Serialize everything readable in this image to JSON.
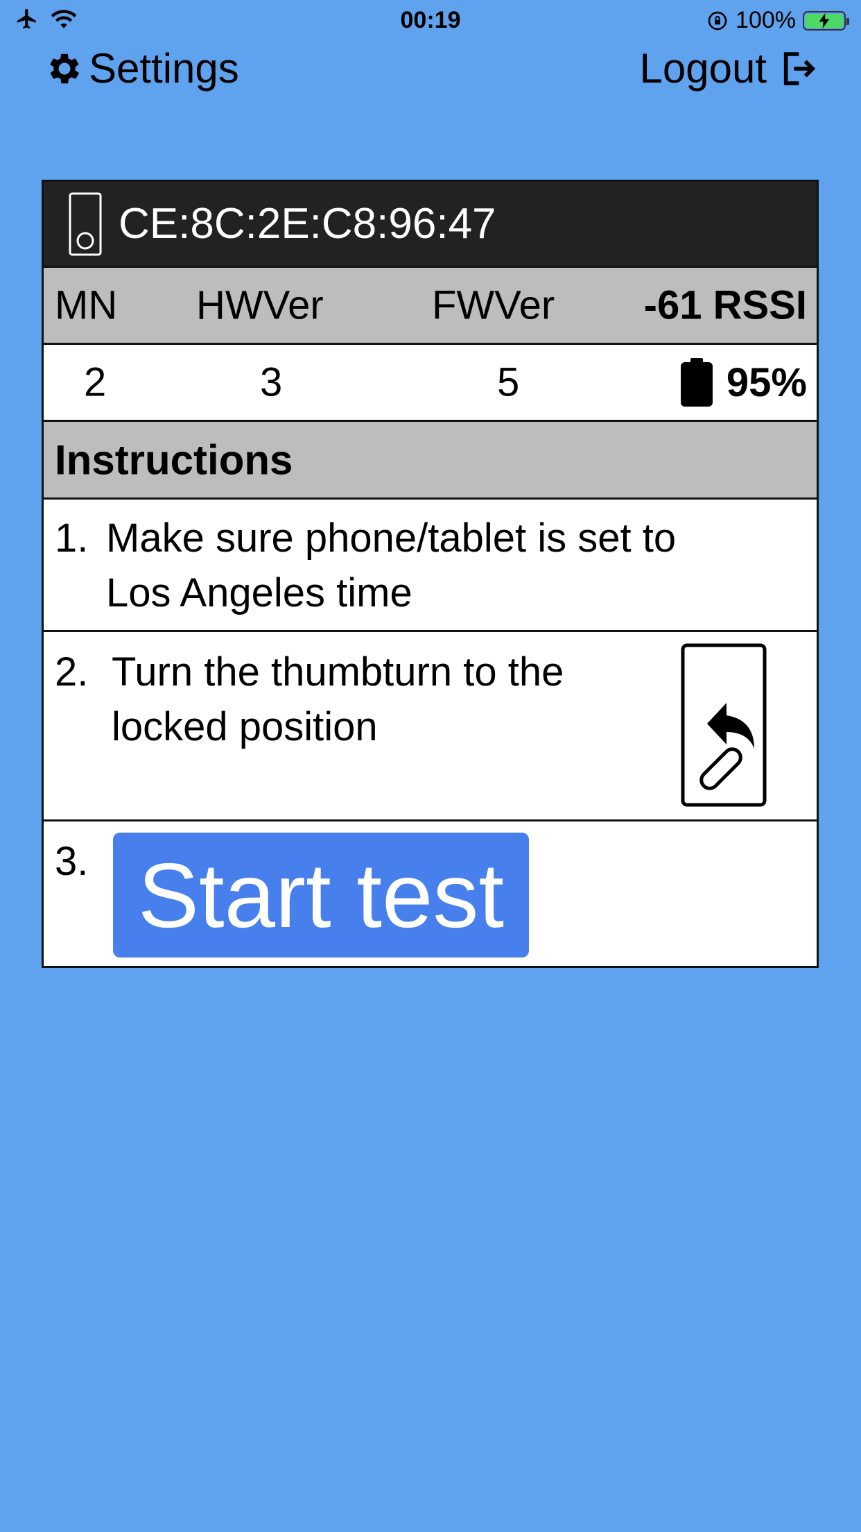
{
  "status_bar": {
    "time": "00:19",
    "battery": "100%"
  },
  "nav": {
    "settings_label": "Settings",
    "logout_label": "Logout"
  },
  "device": {
    "mac": "CE:8C:2E:C8:96:47",
    "headers": {
      "mn": "MN",
      "hwver": "HWVer",
      "fwver": "FWVer",
      "rssi": "-61 RSSI"
    },
    "values": {
      "mn": "2",
      "hwver": "3",
      "fwver": "5",
      "battery": "95%"
    }
  },
  "instructions": {
    "title": "Instructions",
    "steps": [
      {
        "num": "1.",
        "line1": "Make sure phone/tablet is set to",
        "line2": "Los Angeles time"
      },
      {
        "num": "2.",
        "line1": "Turn the thumbturn to the",
        "line2": "locked position"
      },
      {
        "num": "3.",
        "button_label": "Start test"
      }
    ]
  },
  "icons": {
    "status_left": [
      "airplane-icon",
      "wifi-icon"
    ],
    "status_right": [
      "orientation-lock-icon",
      "battery-charging-icon"
    ],
    "settings": "gear-icon",
    "logout": "logout-icon",
    "device": "lock-device-icon",
    "battery": "battery-icon",
    "thumbturn": "thumbturn-lock-icon"
  }
}
